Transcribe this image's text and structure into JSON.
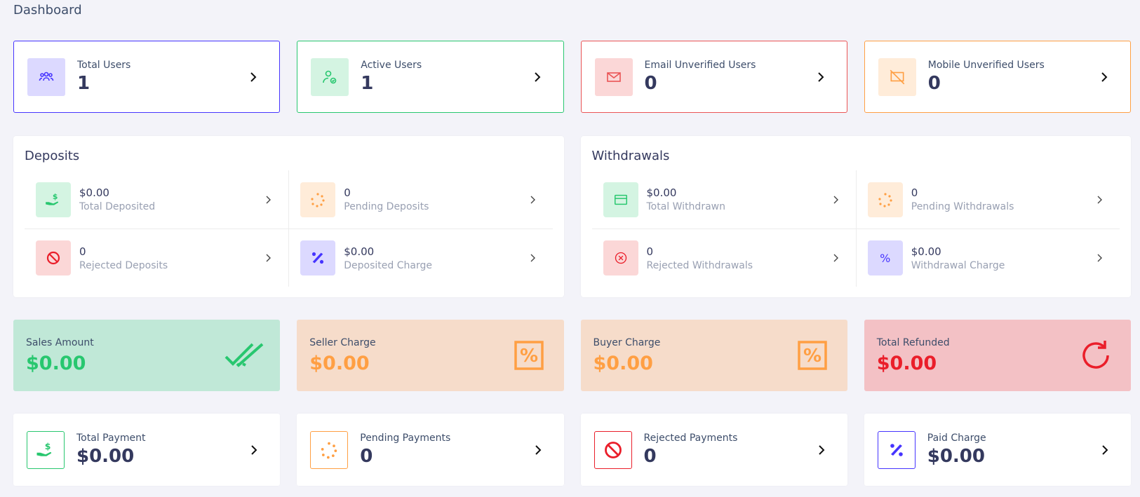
{
  "page": {
    "title": "Dashboard"
  },
  "widgets": [
    {
      "label": "Total Users",
      "value": "1",
      "icon": "users-icon",
      "color": "#4634ff",
      "bg": "#dcd9ff"
    },
    {
      "label": "Active Users",
      "value": "1",
      "icon": "user-check-icon",
      "color": "#28c76f",
      "bg": "#d4f4e2"
    },
    {
      "label": "Email Unverified Users",
      "value": "0",
      "icon": "envelope-icon",
      "color": "#ea5455",
      "bg": "#fbd7d7"
    },
    {
      "label": "Mobile Unverified Users",
      "value": "0",
      "icon": "mobile-off-icon",
      "color": "#ff9f43",
      "bg": "#ffecd9"
    }
  ],
  "deposits": {
    "title": "Deposits",
    "items": [
      {
        "value": "$0.00",
        "label": "Total Deposited",
        "icon": "hand-dollar-icon"
      },
      {
        "value": "0",
        "label": "Pending Deposits",
        "icon": "spinner-icon"
      },
      {
        "value": "0",
        "label": "Rejected Deposits",
        "icon": "ban-icon"
      },
      {
        "value": "$0.00",
        "label": "Deposited Charge",
        "icon": "percent-icon"
      }
    ]
  },
  "withdrawals": {
    "title": "Withdrawals",
    "items": [
      {
        "value": "$0.00",
        "label": "Total Withdrawn",
        "icon": "card-icon"
      },
      {
        "value": "0",
        "label": "Pending Withdrawals",
        "icon": "spinner-icon"
      },
      {
        "value": "0",
        "label": "Rejected Withdrawals",
        "icon": "circle-x-icon"
      },
      {
        "value": "$0.00",
        "label": "Withdrawal Charge",
        "icon": "percent-icon"
      }
    ]
  },
  "summary": [
    {
      "label": "Sales Amount",
      "value": "$0.00",
      "icon": "double-check-icon",
      "color": "#28c76f",
      "bg": "#c0e8d7"
    },
    {
      "label": "Seller Charge",
      "value": "$0.00",
      "icon": "percent-square-icon",
      "color": "#ff9f43",
      "bg": "#f6dcca"
    },
    {
      "label": "Buyer Charge",
      "value": "$0.00",
      "icon": "percent-square-icon",
      "color": "#ff9f43",
      "bg": "#f6dcca"
    },
    {
      "label": "Total Refunded",
      "value": "$0.00",
      "icon": "refresh-icon",
      "color": "#ea1e2a",
      "bg": "#f3c1c5"
    }
  ],
  "payments": [
    {
      "label": "Total Payment",
      "value": "$0.00",
      "icon": "hand-dollar-icon",
      "color": "#28c76f"
    },
    {
      "label": "Pending Payments",
      "value": "0",
      "icon": "spinner-icon",
      "color": "#ff9f43"
    },
    {
      "label": "Rejected Payments",
      "value": "0",
      "icon": "ban-icon",
      "color": "#ea1e2a"
    },
    {
      "label": "Paid Charge",
      "value": "$0.00",
      "icon": "percent-icon",
      "color": "#4634ff"
    }
  ]
}
